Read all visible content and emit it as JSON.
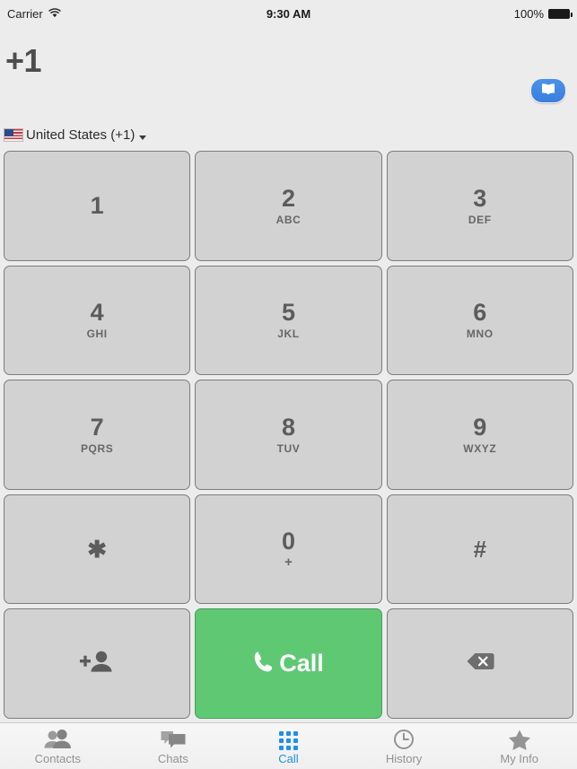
{
  "status_bar": {
    "carrier": "Carrier",
    "wifi_icon": "wifi-icon",
    "time": "9:30 AM",
    "battery_percent": "100%",
    "battery_icon": "battery-full-icon"
  },
  "header": {
    "phone_number": "+1",
    "contacts_button_icon": "address-book-icon",
    "country": {
      "flag_icon": "us-flag-icon",
      "name": "United States (+1)",
      "caret_icon": "chevron-down-icon"
    }
  },
  "keypad": {
    "keys": [
      {
        "name": "key-1",
        "digit": "1",
        "letters": ""
      },
      {
        "name": "key-2",
        "digit": "2",
        "letters": "ABC"
      },
      {
        "name": "key-3",
        "digit": "3",
        "letters": "DEF"
      },
      {
        "name": "key-4",
        "digit": "4",
        "letters": "GHI"
      },
      {
        "name": "key-5",
        "digit": "5",
        "letters": "JKL"
      },
      {
        "name": "key-6",
        "digit": "6",
        "letters": "MNO"
      },
      {
        "name": "key-7",
        "digit": "7",
        "letters": "PQRS"
      },
      {
        "name": "key-8",
        "digit": "8",
        "letters": "TUV"
      },
      {
        "name": "key-9",
        "digit": "9",
        "letters": "WXYZ"
      },
      {
        "name": "key-star",
        "digit": "✱",
        "letters": ""
      },
      {
        "name": "key-0",
        "digit": "0",
        "letters": "+"
      },
      {
        "name": "key-hash",
        "digit": "#",
        "letters": ""
      }
    ],
    "add_contact_icon": "add-person-icon",
    "call_label": "Call",
    "call_icon": "phone-handset-icon",
    "backspace_icon": "backspace-delete-icon"
  },
  "tabbar": {
    "tabs": [
      {
        "label": "Contacts",
        "icon": "contacts-people-icon",
        "active": false
      },
      {
        "label": "Chats",
        "icon": "chat-bubbles-icon",
        "active": false
      },
      {
        "label": "Call",
        "icon": "keypad-grid-icon",
        "active": true
      },
      {
        "label": "History",
        "icon": "clock-icon",
        "active": false
      },
      {
        "label": "My Info",
        "icon": "star-icon",
        "active": false
      }
    ]
  },
  "colors": {
    "background": "#ececec",
    "key_face": "#d2d2d2",
    "key_border": "#7d7d7d",
    "call_green": "#5fc873",
    "accent_blue": "#1f8fe8",
    "contacts_button_blue": "#4b92e8",
    "text_gray": "#5c5c5c",
    "tab_inactive_gray": "#929292"
  }
}
